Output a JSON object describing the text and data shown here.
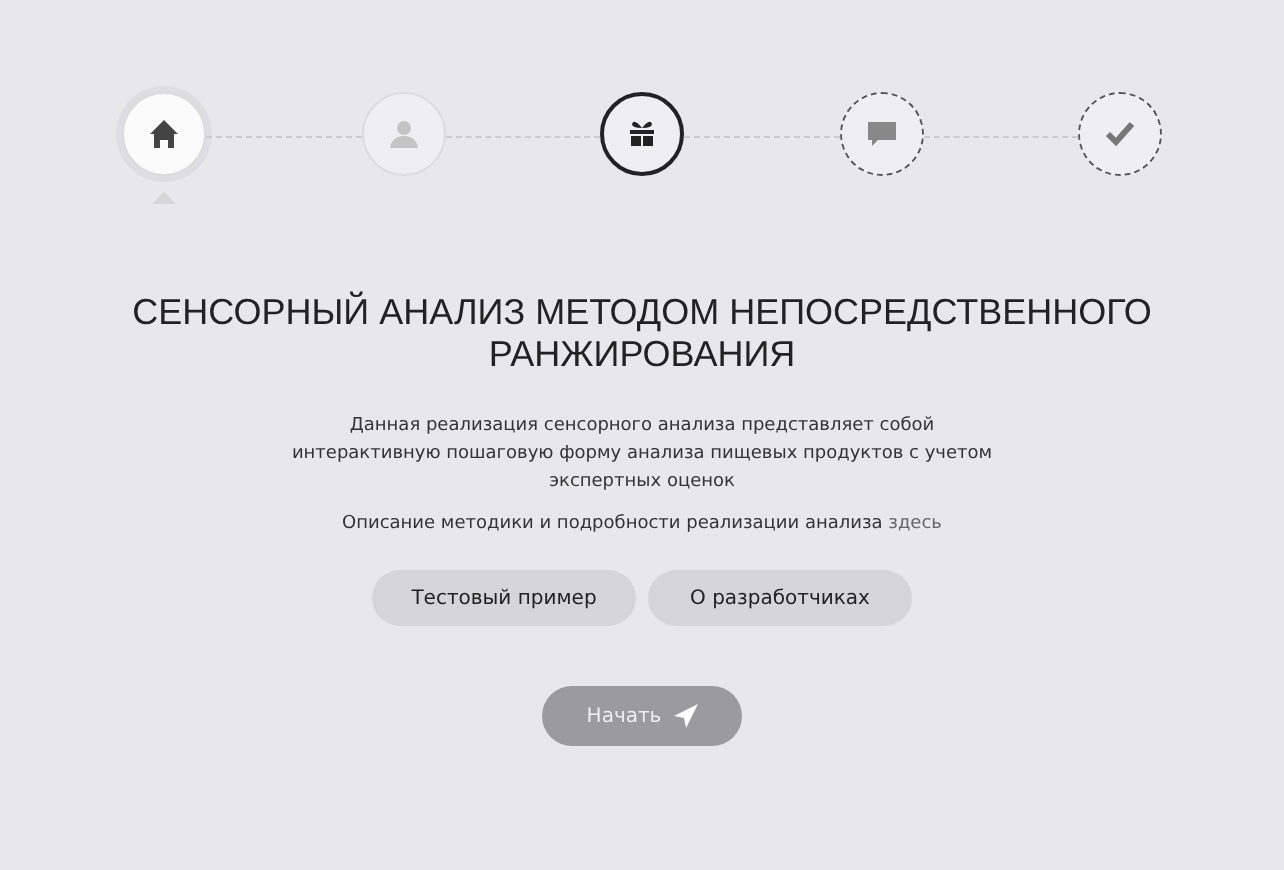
{
  "steps": [
    {
      "kind": "home",
      "selected": true,
      "current": false,
      "disabled": true
    },
    {
      "kind": "user",
      "selected": false,
      "current": false,
      "disabled": true
    },
    {
      "kind": "gift",
      "selected": false,
      "current": true,
      "disabled": false
    },
    {
      "kind": "chat",
      "selected": false,
      "current": false,
      "disabled": false
    },
    {
      "kind": "check",
      "selected": false,
      "current": false,
      "disabled": false
    }
  ],
  "title": "СЕНСОРНЫЙ АНАЛИЗ МЕТОДОМ НЕПОСРЕДСТВЕННОГО РАНЖИРОВАНИЯ",
  "description": "Данная реализация сенсорного анализа представляет собой интерактивную пошаговую форму анализа пищевых продуктов с учетом экспертных оценок",
  "details": {
    "text": "Описание методики и подробности реализации анализа",
    "link": "здесь"
  },
  "buttons": [
    "Тестовый пример",
    "О разработчиках"
  ],
  "start_button": "Начать"
}
